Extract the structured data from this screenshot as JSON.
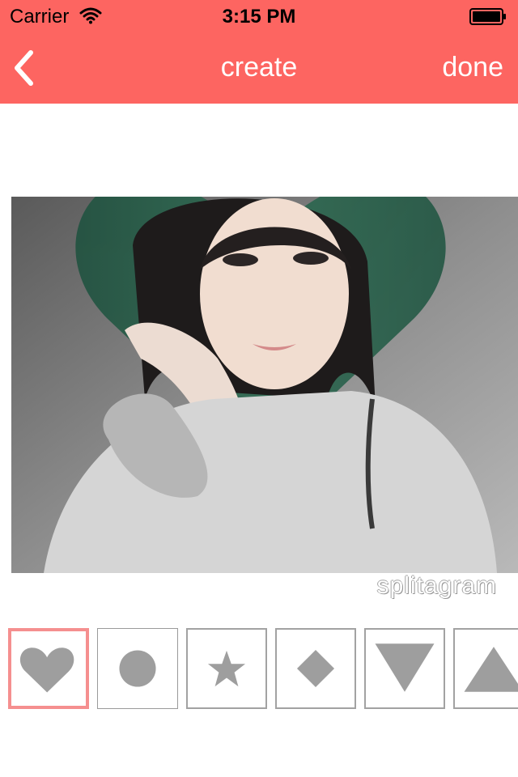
{
  "status_bar": {
    "carrier": "Carrier",
    "time": "3:15 PM",
    "wifi_icon": "wifi-icon",
    "battery_icon": "battery-full-icon"
  },
  "nav_bar": {
    "back_icon": "chevron-left-icon",
    "title": "create",
    "done_label": "done",
    "background_color": "#fd6561",
    "text_color": "#ffffff"
  },
  "editor": {
    "mask_shape": "heart",
    "watermark": "splitagram"
  },
  "shapes": {
    "items": [
      {
        "name": "heart",
        "selected": true
      },
      {
        "name": "circle",
        "selected": false
      },
      {
        "name": "star",
        "selected": false
      },
      {
        "name": "diamond",
        "selected": false
      },
      {
        "name": "triangle-down",
        "selected": false
      },
      {
        "name": "triangle-up",
        "selected": false
      }
    ],
    "selected_border_color": "#f58f8f",
    "icon_color": "#9e9e9e"
  }
}
